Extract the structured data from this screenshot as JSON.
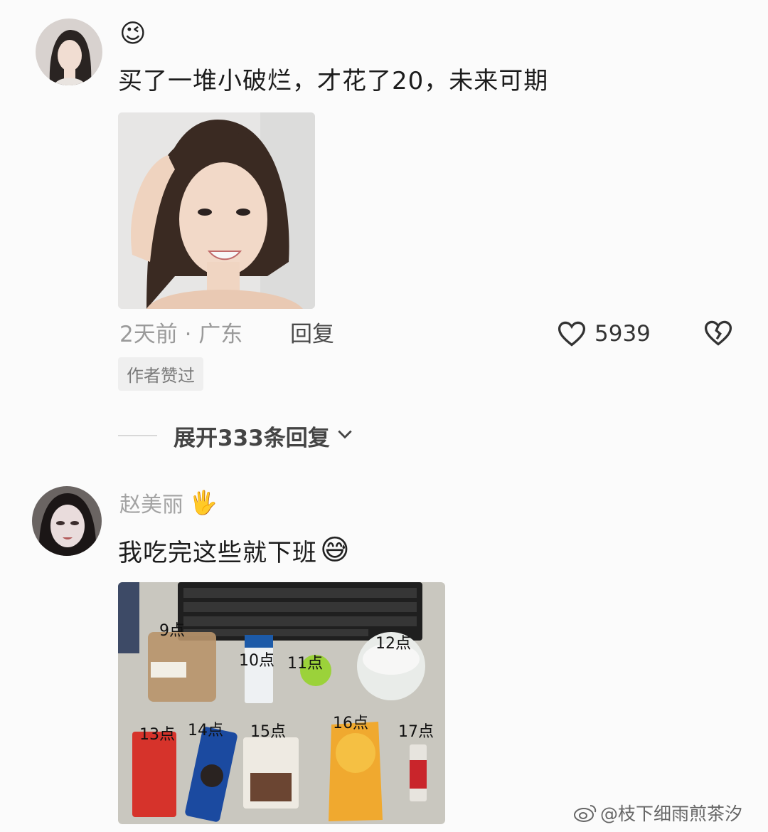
{
  "comment1": {
    "emoji": "😉",
    "text": "买了一堆小破烂，才花了20，未来可期",
    "time_location": "2天前 · 广东",
    "reply_label": "回复",
    "like_count": "5939",
    "author_liked_tag": "作者赞过"
  },
  "expand_replies": {
    "label": "展开333条回复"
  },
  "comment2": {
    "username": "赵美丽",
    "username_emoji": "🖐",
    "text": "我吃完这些就下班",
    "text_emoji": "😅",
    "photo_labels": [
      "9点",
      "10点",
      "11点",
      "12点",
      "13点",
      "14点",
      "15点",
      "16点",
      "17点"
    ]
  },
  "watermark": {
    "text": "@枝下细雨煎茶汐"
  },
  "colors": {
    "background": "#fbfbfb",
    "meta_gray": "#9a9a9a",
    "tag_background": "#efefef"
  }
}
